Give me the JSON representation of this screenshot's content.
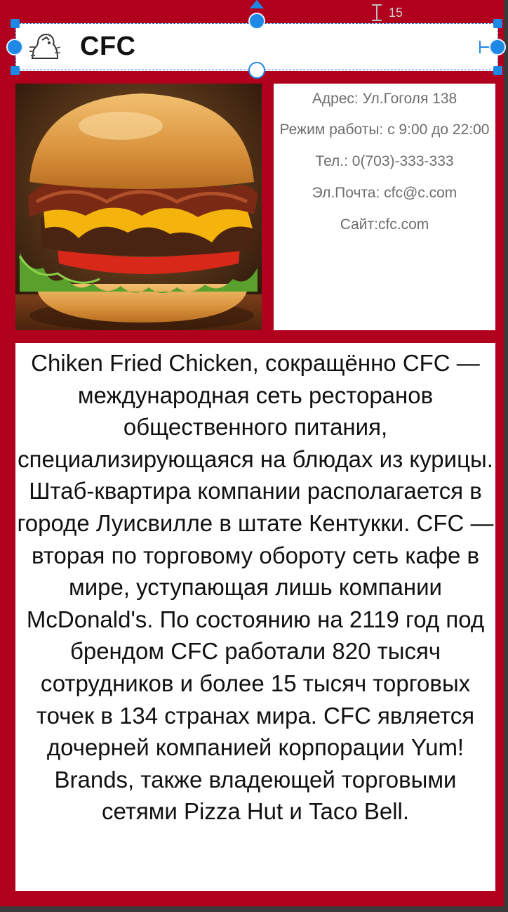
{
  "header": {
    "brand": "CFC",
    "logo_icon": "chicken-logo-icon"
  },
  "editor": {
    "margin_value": "15",
    "selection_color": "#1e88e5"
  },
  "photo": {
    "subject": "burger-photo"
  },
  "info": {
    "address": "Адрес: Ул.Гоголя 138",
    "hours": "Режим работы: с 9:00 до 22:00",
    "phone": "Тел.: 0(703)-333-333",
    "email": "Эл.Почта: cfc@c.com",
    "site": "Сайт:cfc.com"
  },
  "description": {
    "text": "Chiken Fried Chicken, сокращённо CFC — международная сеть ресторанов общественного питания, специализирующаяся на блюдах из курицы. Штаб-квартира компании располагается в городе Луисвилле в штате Кентукки. CFC — вторая по торговому обороту сеть кафе в мире, уступающая лишь компании McDonald's. По состоянию на 2119 год под брендом CFC работали 820 тысяч сотрудников и более 15 тысяч торговых точек в 134 странах мира. CFC является дочерней компанией корпорации Yum! Brands, также владеющей торговыми сетями Pizza Hut и Taco Bell."
  },
  "colors": {
    "background": "#b0001e",
    "panel": "#ffffff",
    "info_text": "#6d6d6d"
  }
}
